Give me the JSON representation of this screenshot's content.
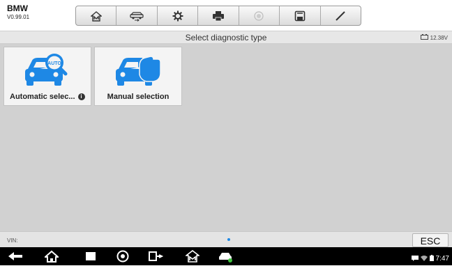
{
  "app": {
    "name": "BMW",
    "version": "V0.99.01"
  },
  "toolbar": {
    "buttons": [
      "home-icon",
      "vehicle-swap-icon",
      "gear-icon",
      "printer-icon",
      "help-icon",
      "save-icon",
      "pen-icon"
    ]
  },
  "titlebar": {
    "title": "Select diagnostic type",
    "battery_voltage": "12.38V"
  },
  "tiles": [
    {
      "label": "Automatic selec...",
      "icon": "car-auto-search-icon"
    },
    {
      "label": "Manual selection",
      "icon": "car-hand-icon"
    }
  ],
  "footer": {
    "vin_label": "VIN:",
    "esc_label": "ESC"
  },
  "system": {
    "time": "7:47"
  },
  "colors": {
    "accent": "#1e88e5",
    "content_bg": "#d1d1d1"
  }
}
